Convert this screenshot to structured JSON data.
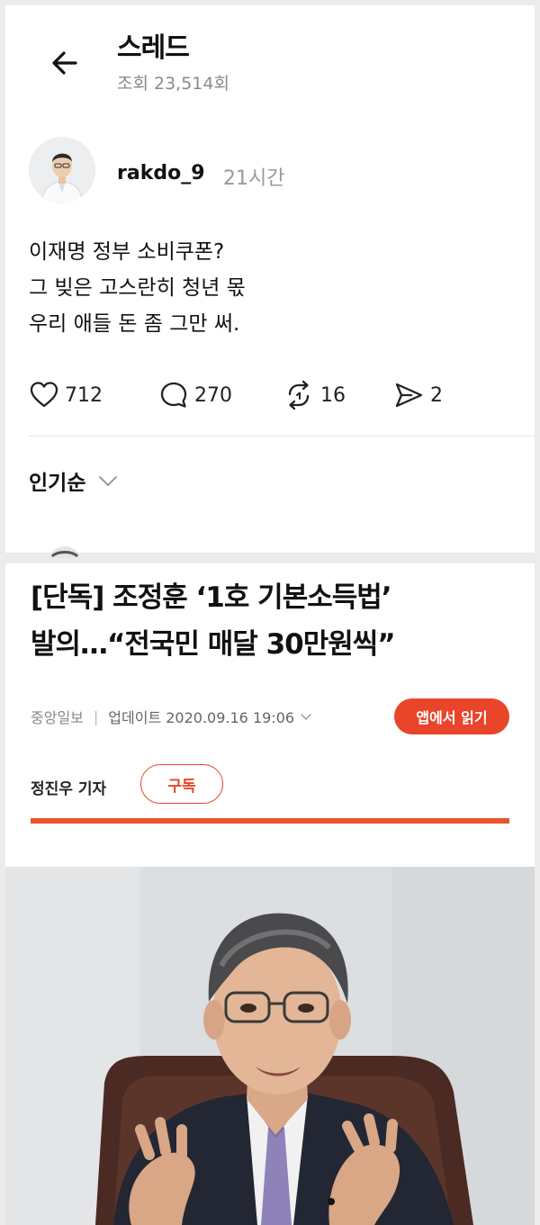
{
  "thread": {
    "title": "스레드",
    "views": "조회 23,514회",
    "author": "rakdo_9",
    "time": "21시간",
    "post_lines": [
      "이재명 정부 소비쿠폰?",
      "그 빚은 고스란히 청년 몫",
      "우리 애들 돈 좀 그만 써."
    ],
    "actions": {
      "likes": "712",
      "comments": "270",
      "reposts": "16",
      "shares": "2"
    },
    "sort_label": "인기순"
  },
  "article": {
    "headline_lines": [
      "[단독] 조정훈 ‘1호 기본소득법’",
      "발의…“전국민 매달 30만원씩”"
    ],
    "source": "중앙일보",
    "updated": "업데이트 2020.09.16 19:06",
    "app_button": "앱에서 읽기",
    "reporter": "정진우 기자",
    "subscribe": "구독"
  },
  "colors": {
    "accent": "#e8452a",
    "muted_text": "#8a8a8a"
  },
  "icons": [
    "back-arrow-icon",
    "heart-icon",
    "comment-icon",
    "repost-icon",
    "share-icon",
    "chevron-down-icon"
  ]
}
